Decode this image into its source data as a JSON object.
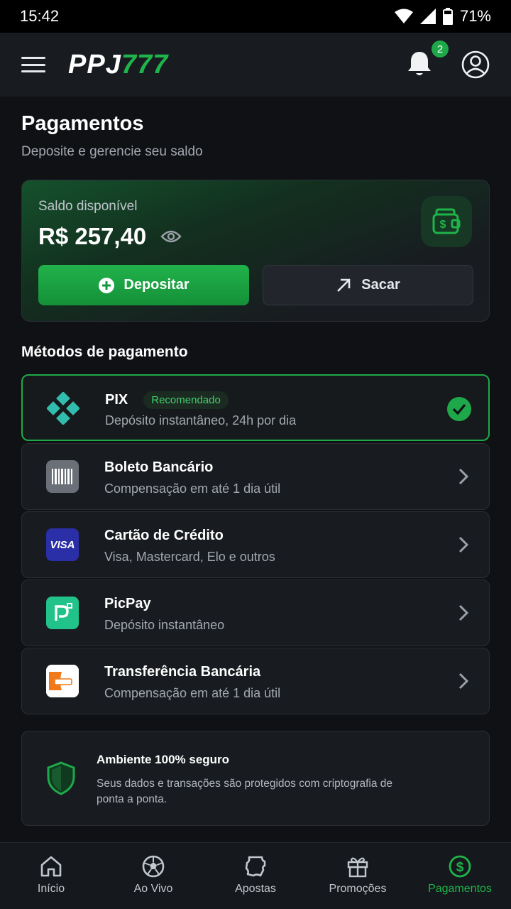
{
  "status_bar": {
    "time": "15:42",
    "battery": "71%"
  },
  "header": {
    "logo_white": "PPJ",
    "logo_green": "777",
    "notification_count": "2"
  },
  "page": {
    "title": "Pagamentos",
    "subtitle": "Deposite e gerencie seu saldo"
  },
  "balance": {
    "label": "Saldo disponível",
    "value": "R$ 257,40",
    "deposit_label": "Depositar",
    "withdraw_label": "Sacar"
  },
  "methods_title": "Métodos de pagamento",
  "methods": [
    {
      "name": "PIX",
      "tag": "Recomendado",
      "desc": "Depósito instantâneo, 24h por dia",
      "selected": true
    },
    {
      "name": "Boleto Bancário",
      "desc": "Compensação em até 1 dia útil"
    },
    {
      "name": "Cartão de Crédito",
      "desc": "Visa, Mastercard, Elo e outros",
      "icon_text": "VISA"
    },
    {
      "name": "PicPay",
      "desc": "Depósito instantâneo"
    },
    {
      "name": "Transferência Bancária",
      "desc": "Compensação em até 1 dia útil"
    }
  ],
  "secure": {
    "title": "Ambiente 100% seguro",
    "text": "Seus dados e transações são protegidos com criptografia de ponta a ponta."
  },
  "nav": [
    {
      "label": "Início"
    },
    {
      "label": "Ao Vivo"
    },
    {
      "label": "Apostas"
    },
    {
      "label": "Promoções"
    },
    {
      "label": "Pagamentos",
      "active": true
    }
  ],
  "colors": {
    "accent": "#1fa84a",
    "background": "#0f1114",
    "card": "#181b20",
    "visa": "#2a2fa8",
    "picpay": "#21c38a",
    "pix": "#32bcad"
  }
}
